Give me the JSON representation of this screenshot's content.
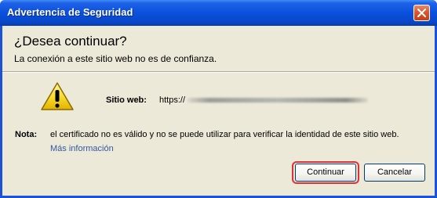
{
  "window": {
    "title": "Advertencia de Seguridad"
  },
  "message": {
    "heading": "¿Desea continuar?",
    "subheading": "La conexión a este sitio web no es de confianza."
  },
  "site": {
    "label": "Sitio web:",
    "url_prefix": "https://"
  },
  "note": {
    "label": "Nota:",
    "text": "el certificado no es válido y no se puede utilizar para verificar la identidad de este sitio web.",
    "more_info_link": "Más información"
  },
  "buttons": {
    "continue_label": "Continuar",
    "cancel_label": "Cancelar"
  },
  "colors": {
    "titlebar": "#0a50dd",
    "client_bg": "#ece9d8",
    "link": "#2f59a6",
    "highlight_ring": "#e0303a",
    "close_button": "#d9572f"
  },
  "icons": {
    "warning": "warning-triangle-icon",
    "close": "close-icon"
  }
}
